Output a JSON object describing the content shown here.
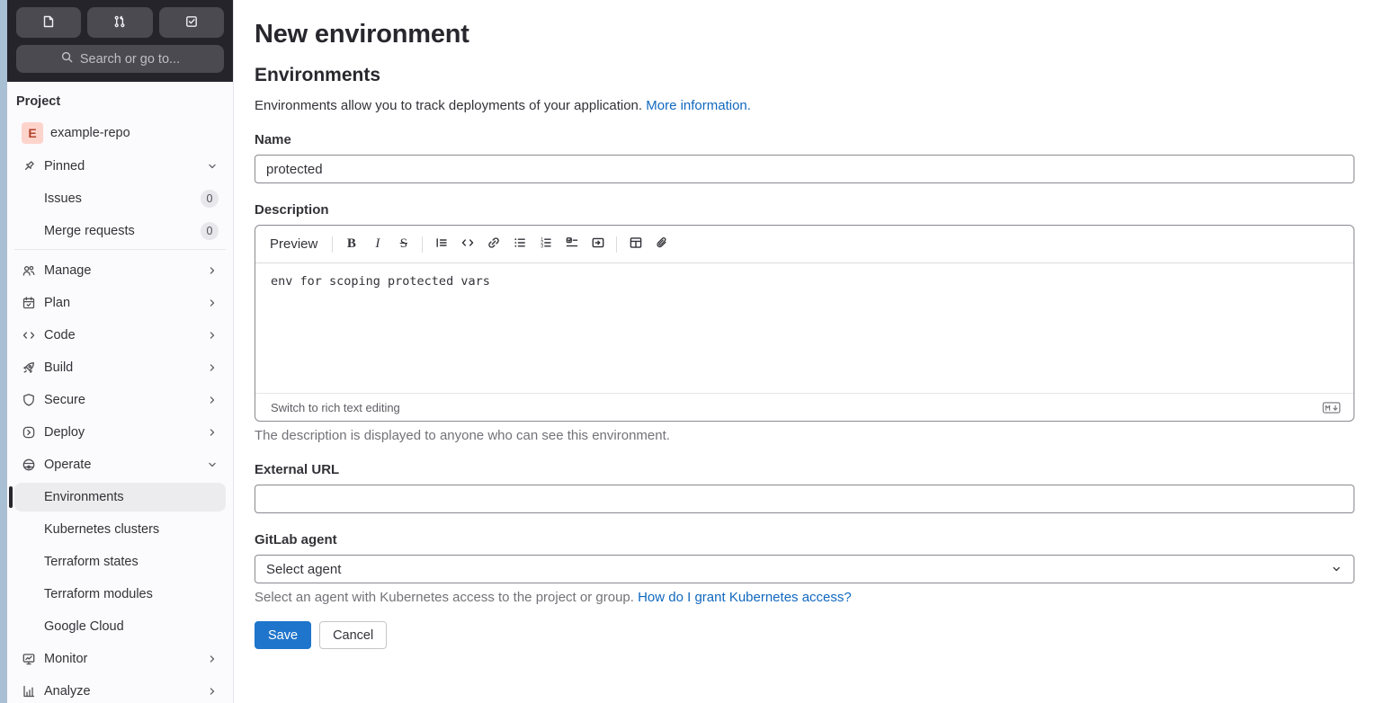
{
  "colors": {
    "accent_blue": "#1f75cb",
    "link_blue": "#1068bf",
    "header_bg": "#26242b",
    "sidebar_bg": "#fbfafd",
    "active_item_bg": "#ececef",
    "avatar_bg": "#fdd4cc",
    "avatar_text": "#b2432e"
  },
  "sidebar": {
    "search_placeholder": "Search or go to...",
    "section_label": "Project",
    "project_avatar_letter": "E",
    "project_name": "example-repo",
    "pinned_label": "Pinned",
    "pinned_items": [
      {
        "label": "Issues",
        "badge": "0"
      },
      {
        "label": "Merge requests",
        "badge": "0"
      }
    ],
    "nav_items": [
      {
        "label": "Manage"
      },
      {
        "label": "Plan"
      },
      {
        "label": "Code"
      },
      {
        "label": "Build"
      },
      {
        "label": "Secure"
      },
      {
        "label": "Deploy"
      },
      {
        "label": "Operate"
      }
    ],
    "operate_children": [
      {
        "label": "Environments"
      },
      {
        "label": "Kubernetes clusters"
      },
      {
        "label": "Terraform states"
      },
      {
        "label": "Terraform modules"
      },
      {
        "label": "Google Cloud"
      }
    ],
    "bottom_items": [
      {
        "label": "Monitor"
      },
      {
        "label": "Analyze"
      }
    ]
  },
  "main": {
    "page_title": "New environment",
    "section_title": "Environments",
    "intro_text": "Environments allow you to track deployments of your application.",
    "intro_link": "More information.",
    "name": {
      "label": "Name",
      "value": "protected"
    },
    "description": {
      "label": "Description",
      "toolbar": {
        "preview": "Preview",
        "bold": "B",
        "italic": "I",
        "strike": "S"
      },
      "value": "env for scoping protected vars",
      "switch_link": "Switch to rich text editing",
      "markdown_badge": "M",
      "help": "The description is displayed to anyone who can see this environment."
    },
    "external_url": {
      "label": "External URL",
      "value": ""
    },
    "gitlab_agent": {
      "label": "GitLab agent",
      "selected": "Select agent",
      "help": "Select an agent with Kubernetes access to the project or group.",
      "help_link": "How do I grant Kubernetes access?"
    },
    "actions": {
      "save": "Save",
      "cancel": "Cancel"
    }
  }
}
